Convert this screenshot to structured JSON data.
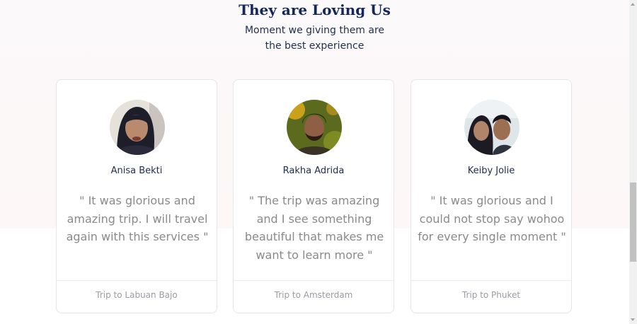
{
  "section": {
    "title": "They are Loving Us",
    "subtitle_lines": [
      "Moment we giving them are",
      "the best experience"
    ]
  },
  "testimonials": [
    {
      "name": "Anisa Bekti",
      "quote": "\" It was glorious and amazing trip. I will travel again with this services \"",
      "trip": "Trip to Labuan Bajo"
    },
    {
      "name": "Rakha Adrida",
      "quote": "\" The trip was amazing and I see something beautiful that makes me want to learn more \"",
      "trip": "Trip to Amsterdam"
    },
    {
      "name": "Keiby Jolie",
      "quote": "\" It was glorious and I could not stop say wohoo for every single moment \"",
      "trip": "Trip to Phuket"
    }
  ],
  "colors": {
    "title": "#14275a",
    "quote": "#8a8a8a",
    "card_border": "#e5e5ea"
  },
  "icons": [
    "scroll-up-arrow-icon",
    "scroll-down-arrow-icon"
  ]
}
